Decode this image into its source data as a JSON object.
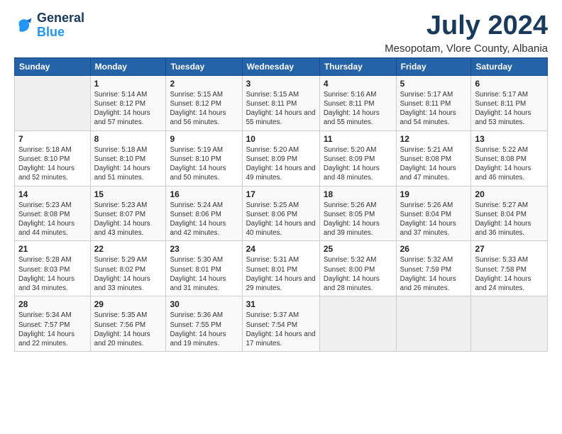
{
  "logo": {
    "line1": "General",
    "line2": "Blue"
  },
  "title": "July 2024",
  "subtitle": "Mesopotam, Vlore County, Albania",
  "days_header": [
    "Sunday",
    "Monday",
    "Tuesday",
    "Wednesday",
    "Thursday",
    "Friday",
    "Saturday"
  ],
  "weeks": [
    [
      {
        "day": "",
        "sunrise": "",
        "sunset": "",
        "daylight": ""
      },
      {
        "day": "1",
        "sunrise": "Sunrise: 5:14 AM",
        "sunset": "Sunset: 8:12 PM",
        "daylight": "Daylight: 14 hours and 57 minutes."
      },
      {
        "day": "2",
        "sunrise": "Sunrise: 5:15 AM",
        "sunset": "Sunset: 8:12 PM",
        "daylight": "Daylight: 14 hours and 56 minutes."
      },
      {
        "day": "3",
        "sunrise": "Sunrise: 5:15 AM",
        "sunset": "Sunset: 8:11 PM",
        "daylight": "Daylight: 14 hours and 55 minutes."
      },
      {
        "day": "4",
        "sunrise": "Sunrise: 5:16 AM",
        "sunset": "Sunset: 8:11 PM",
        "daylight": "Daylight: 14 hours and 55 minutes."
      },
      {
        "day": "5",
        "sunrise": "Sunrise: 5:17 AM",
        "sunset": "Sunset: 8:11 PM",
        "daylight": "Daylight: 14 hours and 54 minutes."
      },
      {
        "day": "6",
        "sunrise": "Sunrise: 5:17 AM",
        "sunset": "Sunset: 8:11 PM",
        "daylight": "Daylight: 14 hours and 53 minutes."
      }
    ],
    [
      {
        "day": "7",
        "sunrise": "Sunrise: 5:18 AM",
        "sunset": "Sunset: 8:10 PM",
        "daylight": "Daylight: 14 hours and 52 minutes."
      },
      {
        "day": "8",
        "sunrise": "Sunrise: 5:18 AM",
        "sunset": "Sunset: 8:10 PM",
        "daylight": "Daylight: 14 hours and 51 minutes."
      },
      {
        "day": "9",
        "sunrise": "Sunrise: 5:19 AM",
        "sunset": "Sunset: 8:10 PM",
        "daylight": "Daylight: 14 hours and 50 minutes."
      },
      {
        "day": "10",
        "sunrise": "Sunrise: 5:20 AM",
        "sunset": "Sunset: 8:09 PM",
        "daylight": "Daylight: 14 hours and 49 minutes."
      },
      {
        "day": "11",
        "sunrise": "Sunrise: 5:20 AM",
        "sunset": "Sunset: 8:09 PM",
        "daylight": "Daylight: 14 hours and 48 minutes."
      },
      {
        "day": "12",
        "sunrise": "Sunrise: 5:21 AM",
        "sunset": "Sunset: 8:08 PM",
        "daylight": "Daylight: 14 hours and 47 minutes."
      },
      {
        "day": "13",
        "sunrise": "Sunrise: 5:22 AM",
        "sunset": "Sunset: 8:08 PM",
        "daylight": "Daylight: 14 hours and 46 minutes."
      }
    ],
    [
      {
        "day": "14",
        "sunrise": "Sunrise: 5:23 AM",
        "sunset": "Sunset: 8:08 PM",
        "daylight": "Daylight: 14 hours and 44 minutes."
      },
      {
        "day": "15",
        "sunrise": "Sunrise: 5:23 AM",
        "sunset": "Sunset: 8:07 PM",
        "daylight": "Daylight: 14 hours and 43 minutes."
      },
      {
        "day": "16",
        "sunrise": "Sunrise: 5:24 AM",
        "sunset": "Sunset: 8:06 PM",
        "daylight": "Daylight: 14 hours and 42 minutes."
      },
      {
        "day": "17",
        "sunrise": "Sunrise: 5:25 AM",
        "sunset": "Sunset: 8:06 PM",
        "daylight": "Daylight: 14 hours and 40 minutes."
      },
      {
        "day": "18",
        "sunrise": "Sunrise: 5:26 AM",
        "sunset": "Sunset: 8:05 PM",
        "daylight": "Daylight: 14 hours and 39 minutes."
      },
      {
        "day": "19",
        "sunrise": "Sunrise: 5:26 AM",
        "sunset": "Sunset: 8:04 PM",
        "daylight": "Daylight: 14 hours and 37 minutes."
      },
      {
        "day": "20",
        "sunrise": "Sunrise: 5:27 AM",
        "sunset": "Sunset: 8:04 PM",
        "daylight": "Daylight: 14 hours and 36 minutes."
      }
    ],
    [
      {
        "day": "21",
        "sunrise": "Sunrise: 5:28 AM",
        "sunset": "Sunset: 8:03 PM",
        "daylight": "Daylight: 14 hours and 34 minutes."
      },
      {
        "day": "22",
        "sunrise": "Sunrise: 5:29 AM",
        "sunset": "Sunset: 8:02 PM",
        "daylight": "Daylight: 14 hours and 33 minutes."
      },
      {
        "day": "23",
        "sunrise": "Sunrise: 5:30 AM",
        "sunset": "Sunset: 8:01 PM",
        "daylight": "Daylight: 14 hours and 31 minutes."
      },
      {
        "day": "24",
        "sunrise": "Sunrise: 5:31 AM",
        "sunset": "Sunset: 8:01 PM",
        "daylight": "Daylight: 14 hours and 29 minutes."
      },
      {
        "day": "25",
        "sunrise": "Sunrise: 5:32 AM",
        "sunset": "Sunset: 8:00 PM",
        "daylight": "Daylight: 14 hours and 28 minutes."
      },
      {
        "day": "26",
        "sunrise": "Sunrise: 5:32 AM",
        "sunset": "Sunset: 7:59 PM",
        "daylight": "Daylight: 14 hours and 26 minutes."
      },
      {
        "day": "27",
        "sunrise": "Sunrise: 5:33 AM",
        "sunset": "Sunset: 7:58 PM",
        "daylight": "Daylight: 14 hours and 24 minutes."
      }
    ],
    [
      {
        "day": "28",
        "sunrise": "Sunrise: 5:34 AM",
        "sunset": "Sunset: 7:57 PM",
        "daylight": "Daylight: 14 hours and 22 minutes."
      },
      {
        "day": "29",
        "sunrise": "Sunrise: 5:35 AM",
        "sunset": "Sunset: 7:56 PM",
        "daylight": "Daylight: 14 hours and 20 minutes."
      },
      {
        "day": "30",
        "sunrise": "Sunrise: 5:36 AM",
        "sunset": "Sunset: 7:55 PM",
        "daylight": "Daylight: 14 hours and 19 minutes."
      },
      {
        "day": "31",
        "sunrise": "Sunrise: 5:37 AM",
        "sunset": "Sunset: 7:54 PM",
        "daylight": "Daylight: 14 hours and 17 minutes."
      },
      {
        "day": "",
        "sunrise": "",
        "sunset": "",
        "daylight": ""
      },
      {
        "day": "",
        "sunrise": "",
        "sunset": "",
        "daylight": ""
      },
      {
        "day": "",
        "sunrise": "",
        "sunset": "",
        "daylight": ""
      }
    ]
  ]
}
